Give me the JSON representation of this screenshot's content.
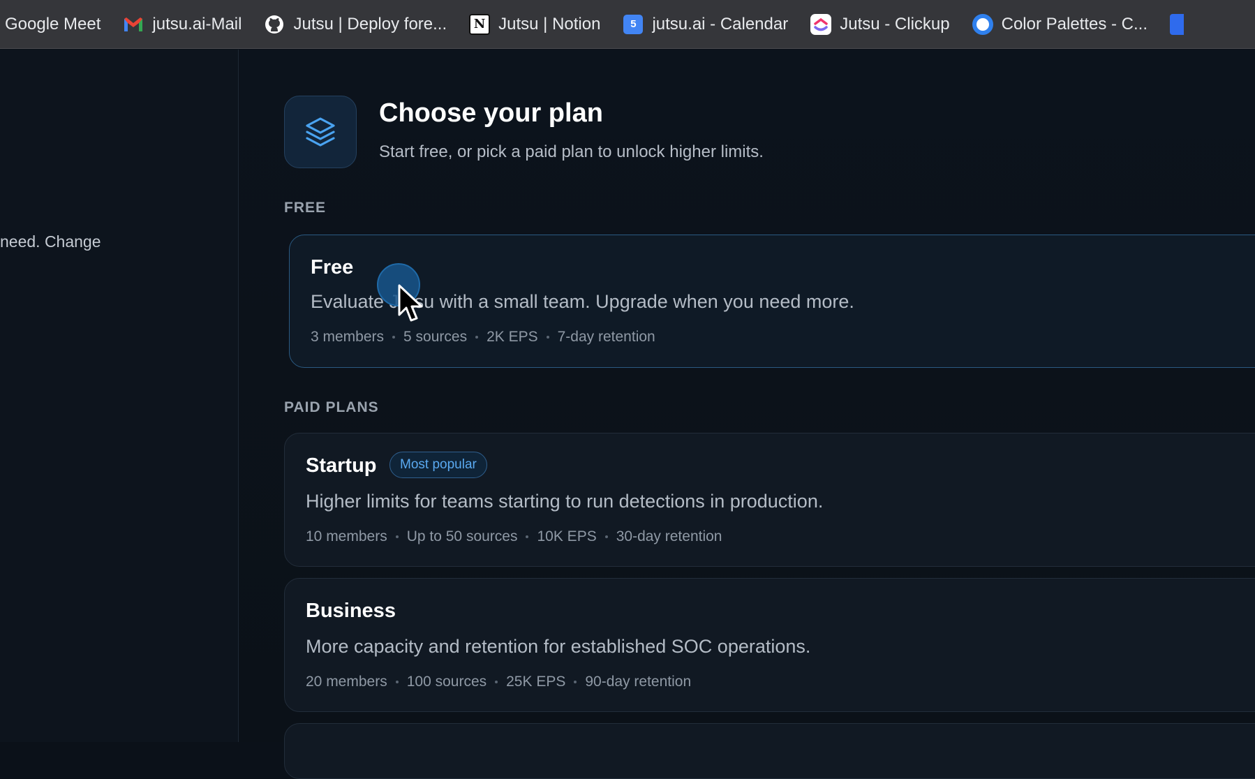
{
  "bookmarks": [
    {
      "label": "Google Meet",
      "icon": "google-meet-icon"
    },
    {
      "label": "jutsu.ai-Mail",
      "icon": "gmail-icon"
    },
    {
      "label": "Jutsu | Deploy fore...",
      "icon": "github-icon"
    },
    {
      "label": "Jutsu | Notion",
      "icon": "notion-icon",
      "glyph": "N"
    },
    {
      "label": "jutsu.ai - Calendar",
      "icon": "calendar-icon",
      "glyph": "5"
    },
    {
      "label": "Jutsu - Clickup",
      "icon": "clickup-icon"
    },
    {
      "label": "Color Palettes - C...",
      "icon": "color-palettes-icon"
    }
  ],
  "sidebar": {
    "text": "need. Change"
  },
  "header": {
    "title": "Choose your plan",
    "subtitle": "Start free, or pick a paid plan to unlock higher limits."
  },
  "sections": {
    "free_label": "FREE",
    "paid_label": "PAID PLANS"
  },
  "plans": {
    "free": {
      "name": "Free",
      "description": "Evaluate Jutsu with a small team. Upgrade when you need more.",
      "limits": [
        "3 members",
        "5 sources",
        "2K EPS",
        "7-day retention"
      ]
    },
    "startup": {
      "name": "Startup",
      "badge": "Most popular",
      "description": "Higher limits for teams starting to run detections in production.",
      "limits": [
        "10 members",
        "Up to 50 sources",
        "10K EPS",
        "30-day retention"
      ]
    },
    "business": {
      "name": "Business",
      "description": "More capacity and retention for established SOC operations.",
      "limits": [
        "20 members",
        "100 sources",
        "25K EPS",
        "90-day retention"
      ]
    }
  },
  "colors": {
    "accent": "#3b9be8",
    "background": "#0b1119",
    "card": "#111923"
  }
}
